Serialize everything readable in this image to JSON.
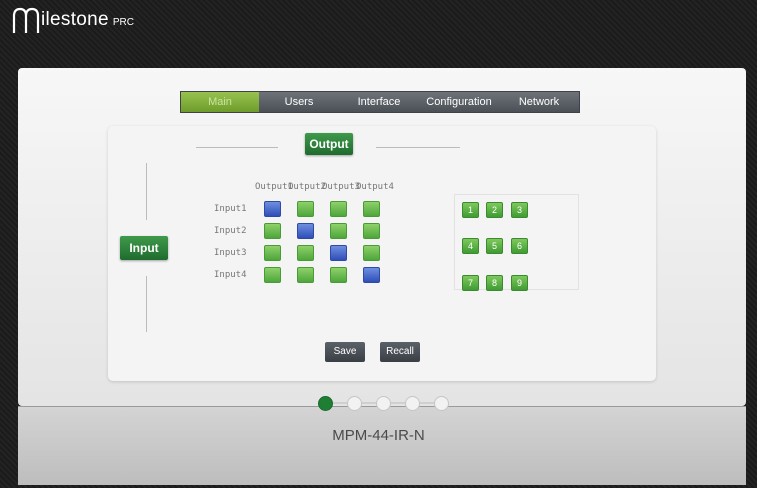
{
  "brand": {
    "name": "ilestone",
    "sub": "PRC"
  },
  "tabs": [
    "Main",
    "Users",
    "Interface",
    "Configuration",
    "Network"
  ],
  "active_tab": 0,
  "matrix": {
    "output_button": "Output",
    "input_button": "Input",
    "outputs": [
      "Output1",
      "Output2",
      "Output3",
      "Output4"
    ],
    "inputs": [
      "Input1",
      "Input2",
      "Input3",
      "Input4"
    ],
    "selected": [
      [
        0,
        0
      ],
      [
        1,
        1
      ],
      [
        2,
        2
      ],
      [
        3,
        3
      ]
    ]
  },
  "presets": [
    "1",
    "2",
    "3",
    "4",
    "5",
    "6",
    "7",
    "8",
    "9"
  ],
  "actions": {
    "save": "Save",
    "recall": "Recall"
  },
  "pager": {
    "count": 5,
    "active": 0
  },
  "model": "MPM-44-IR-N",
  "colors": {
    "green": "#1f6b2e",
    "tab_active": "#98c24e",
    "selected_cell": "#2f4fb8"
  }
}
